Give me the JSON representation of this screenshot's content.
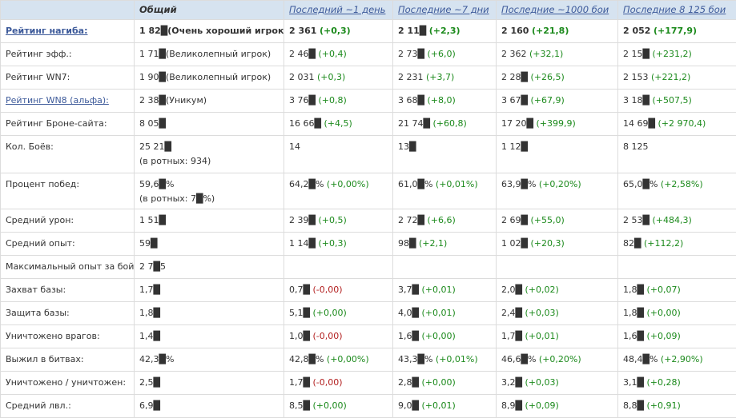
{
  "header": {
    "col0": "",
    "col1": "Общий",
    "col2": "Последний ~1 день",
    "col3": "Последние ~7 дни",
    "col4": "Последние ~1000 бои",
    "col5": "Последние 8 125 бои"
  },
  "rows": [
    {
      "label": "Рейтинг нагиба:",
      "total": "1 82█",
      "total_note": "(Очень хороший игрок)",
      "d1": "2 361",
      "d1_delta": "(+0,3)",
      "d7": "2 11█",
      "d7_delta": "(+2,3)",
      "b1000": "2 160",
      "b1000_delta": "(+21,8)",
      "ball": "2 052",
      "ball_delta": "(+177,9)"
    },
    {
      "label": "Рейтинг эфф.:",
      "total": "1 71█",
      "total_note": "(Великолепный игрок)",
      "d1": "2 46█",
      "d1_delta": "(+0,4)",
      "d7": "2 73█",
      "d7_delta": "(+6,0)",
      "b1000": "2 362",
      "b1000_delta": "(+32,1)",
      "ball": "2 15█",
      "ball_delta": "(+231,2)"
    },
    {
      "label": "Рейтинг WN7:",
      "total": "1 90█",
      "total_note": "(Великолепный игрок)",
      "d1": "2 031",
      "d1_delta": "(+0,3)",
      "d7": "2 231",
      "d7_delta": "(+3,7)",
      "b1000": "2 28█",
      "b1000_delta": "(+26,5)",
      "ball": "2 153",
      "ball_delta": "(+221,2)"
    },
    {
      "label": "Рейтинг WN8 (альфа):",
      "total": "2 38█",
      "total_note": "(Уникум)",
      "d1": "3 76█",
      "d1_delta": "(+0,8)",
      "d7": "3 68█",
      "d7_delta": "(+8,0)",
      "b1000": "3 67█",
      "b1000_delta": "(+67,9)",
      "ball": "3 18█",
      "ball_delta": "(+507,5)"
    },
    {
      "label": "Рейтинг Броне-сайта:",
      "total": "8 05█",
      "total_note": "",
      "d1": "16 66█",
      "d1_delta": "(+4,5)",
      "d7": "21 74█",
      "d7_delta": "(+60,8)",
      "b1000": "17 20█",
      "b1000_delta": "(+399,9)",
      "ball": "14 69█",
      "ball_delta": "(+2 970,4)"
    },
    {
      "label": "Кол. Боёв:",
      "total": "25 21█",
      "total_note": "(в ротных: 934)",
      "d1": "14",
      "d1_delta": "",
      "d7": "13█",
      "d7_delta": "",
      "b1000": "1 12█",
      "b1000_delta": "",
      "ball": "8 125",
      "ball_delta": ""
    },
    {
      "label": "Процент побед:",
      "total": "59,6█%",
      "total_note": "(в ротных: 7█%)",
      "d1": "64,2█%",
      "d1_delta": "(+0,00%)",
      "d7": "61,0█%",
      "d7_delta": "(+0,01%)",
      "b1000": "63,9█%",
      "b1000_delta": "(+0,20%)",
      "ball": "65,0█%",
      "ball_delta": "(+2,58%)"
    },
    {
      "label": "Средний урон:",
      "total": "1 51█",
      "total_note": "",
      "d1": "2 39█",
      "d1_delta": "(+0,5)",
      "d7": "2 72█",
      "d7_delta": "(+6,6)",
      "b1000": "2 69█",
      "b1000_delta": "(+55,0)",
      "ball": "2 53█",
      "ball_delta": "(+484,3)"
    },
    {
      "label": "Средний опыт:",
      "total": "59█",
      "total_note": "",
      "d1": "1 14█",
      "d1_delta": "(+0,3)",
      "d7": "98█",
      "d7_delta": "(+2,1)",
      "b1000": "1 02█",
      "b1000_delta": "(+20,3)",
      "ball": "82█",
      "ball_delta": "(+112,2)"
    },
    {
      "label": "Максимальный опыт за бой:",
      "total": "2 7█5",
      "total_note": "",
      "d1": "",
      "d1_delta": "",
      "d7": "",
      "d7_delta": "",
      "b1000": "",
      "b1000_delta": "",
      "ball": "",
      "ball_delta": ""
    },
    {
      "label": "Захват базы:",
      "total": "1,7█",
      "total_note": "",
      "d1": "0,7█",
      "d1_delta": "(-0,00)",
      "d7": "3,7█",
      "d7_delta": "(+0,01)",
      "b1000": "2,0█",
      "b1000_delta": "(+0,02)",
      "ball": "1,8█",
      "ball_delta": "(+0,07)"
    },
    {
      "label": "Защита базы:",
      "total": "1,8█",
      "total_note": "",
      "d1": "5,1█",
      "d1_delta": "(+0,00)",
      "d7": "4,0█",
      "d7_delta": "(+0,01)",
      "b1000": "2,4█",
      "b1000_delta": "(+0,03)",
      "ball": "1,8█",
      "ball_delta": "(+0,00)"
    },
    {
      "label": "Уничтожено врагов:",
      "total": "1,4█",
      "total_note": "",
      "d1": "1,0█",
      "d1_delta": "(-0,00)",
      "d7": "1,6█",
      "d7_delta": "(+0,00)",
      "b1000": "1,7█",
      "b1000_delta": "(+0,01)",
      "ball": "1,6█",
      "ball_delta": "(+0,09)"
    },
    {
      "label": "Выжил в битвах:",
      "total": "42,3█%",
      "total_note": "",
      "d1": "42,8█%",
      "d1_delta": "(+0,00%)",
      "d7": "43,3█%",
      "d7_delta": "(+0,01%)",
      "b1000": "46,6█%",
      "b1000_delta": "(+0,20%)",
      "ball": "48,4█%",
      "ball_delta": "(+2,90%)"
    },
    {
      "label": "Уничтожено / уничтожен:",
      "total": "2,5█",
      "total_note": "",
      "d1": "1,7█",
      "d1_delta": "(-0,00)",
      "d7": "2,8█",
      "d7_delta": "(+0,00)",
      "b1000": "3,2█",
      "b1000_delta": "(+0,03)",
      "ball": "3,1█",
      "ball_delta": "(+0,28)"
    },
    {
      "label": "Средний лвл.:",
      "total": "6,9█",
      "total_note": "",
      "d1": "8,5█",
      "d1_delta": "(+0,00)",
      "d7": "9,0█",
      "d7_delta": "(+0,01)",
      "b1000": "8,9█",
      "b1000_delta": "(+0,09)",
      "ball": "8,8█",
      "ball_delta": "(+0,91)"
    }
  ],
  "colors": {
    "header_bg": "#d6e3f0",
    "link": "#3d5a9a",
    "positive": "#1c8a1c",
    "negative": "#b21f1f",
    "border": "#dcdcdc"
  }
}
